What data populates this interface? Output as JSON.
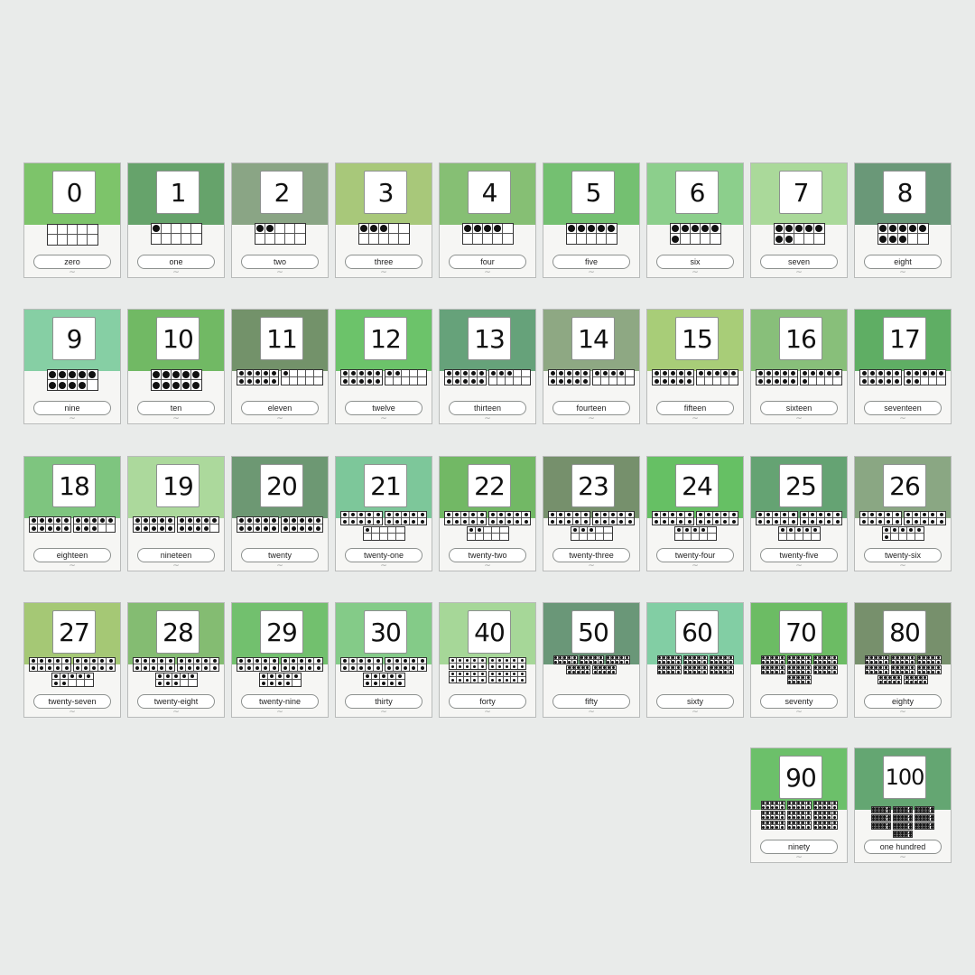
{
  "tilde_glyph": "~",
  "cards": [
    {
      "numeral": "0",
      "word": "zero",
      "value": 0,
      "color": "#7dc46a"
    },
    {
      "numeral": "1",
      "word": "one",
      "value": 1,
      "color": "#66a36b"
    },
    {
      "numeral": "2",
      "word": "two",
      "value": 2,
      "color": "#8aa585"
    },
    {
      "numeral": "3",
      "word": "three",
      "value": 3,
      "color": "#a8c87a"
    },
    {
      "numeral": "4",
      "word": "four",
      "value": 4,
      "color": "#86bf74"
    },
    {
      "numeral": "5",
      "word": "five",
      "value": 5,
      "color": "#74c071"
    },
    {
      "numeral": "6",
      "word": "six",
      "value": 6,
      "color": "#8ccf8c"
    },
    {
      "numeral": "7",
      "word": "seven",
      "value": 7,
      "color": "#aad99a"
    },
    {
      "numeral": "8",
      "word": "eight",
      "value": 8,
      "color": "#6a9878"
    },
    {
      "numeral": "9",
      "word": "nine",
      "value": 9,
      "color": "#86cfa4"
    },
    {
      "numeral": "10",
      "word": "ten",
      "value": 10,
      "color": "#71b964"
    },
    {
      "numeral": "11",
      "word": "eleven",
      "value": 11,
      "color": "#73926a"
    },
    {
      "numeral": "12",
      "word": "twelve",
      "value": 12,
      "color": "#6cc36a"
    },
    {
      "numeral": "13",
      "word": "thirteen",
      "value": 13,
      "color": "#66a27a"
    },
    {
      "numeral": "14",
      "word": "fourteen",
      "value": 14,
      "color": "#8ea883"
    },
    {
      "numeral": "15",
      "word": "fifteen",
      "value": 15,
      "color": "#a8cd78"
    },
    {
      "numeral": "16",
      "word": "sixteen",
      "value": 16,
      "color": "#88bf7a"
    },
    {
      "numeral": "17",
      "word": "seventeen",
      "value": 17,
      "color": "#5fae64"
    },
    {
      "numeral": "18",
      "word": "eighteen",
      "value": 18,
      "color": "#7ec57f"
    },
    {
      "numeral": "19",
      "word": "nineteen",
      "value": 19,
      "color": "#acd99c"
    },
    {
      "numeral": "20",
      "word": "twenty",
      "value": 20,
      "color": "#6d9873"
    },
    {
      "numeral": "21",
      "word": "twenty-one",
      "value": 21,
      "color": "#7dc79a"
    },
    {
      "numeral": "22",
      "word": "twenty-two",
      "value": 22,
      "color": "#72b865"
    },
    {
      "numeral": "23",
      "word": "twenty-three",
      "value": 23,
      "color": "#76906c"
    },
    {
      "numeral": "24",
      "word": "twenty-four",
      "value": 24,
      "color": "#66c064"
    },
    {
      "numeral": "25",
      "word": "twenty-five",
      "value": 25,
      "color": "#65a373"
    },
    {
      "numeral": "26",
      "word": "twenty-six",
      "value": 26,
      "color": "#8aa783"
    },
    {
      "numeral": "27",
      "word": "twenty-seven",
      "value": 27,
      "color": "#a5c875"
    },
    {
      "numeral": "28",
      "word": "twenty-eight",
      "value": 28,
      "color": "#84bc72"
    },
    {
      "numeral": "29",
      "word": "twenty-nine",
      "value": 29,
      "color": "#72c06e"
    },
    {
      "numeral": "30",
      "word": "thirty",
      "value": 30,
      "color": "#84cb88"
    },
    {
      "numeral": "40",
      "word": "forty",
      "value": 40,
      "color": "#a6d798"
    },
    {
      "numeral": "50",
      "word": "fifty",
      "value": 50,
      "color": "#6a9778"
    },
    {
      "numeral": "60",
      "word": "sixty",
      "value": 60,
      "color": "#82cea4"
    },
    {
      "numeral": "70",
      "word": "seventy",
      "value": 70,
      "color": "#6cbc64"
    },
    {
      "numeral": "80",
      "word": "eighty",
      "value": 80,
      "color": "#77906c"
    },
    {
      "numeral": "90",
      "word": "ninety",
      "value": 90,
      "color": "#6cc06a"
    },
    {
      "numeral": "100",
      "word": "one hundred",
      "value": 100,
      "color": "#64a672"
    }
  ]
}
